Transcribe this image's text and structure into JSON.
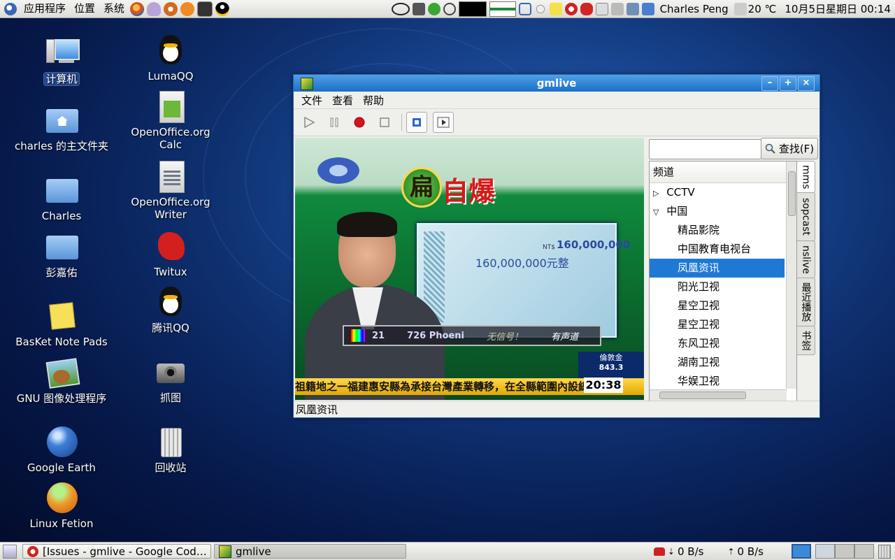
{
  "top_panel": {
    "menus": [
      "应用程序",
      "位置",
      "系统"
    ],
    "user": "Charles Peng",
    "temperature": "20 ℃",
    "clock": "10月5日星期日 00:14"
  },
  "desktop_icons": [
    {
      "label": "计算机",
      "icon": "computer-icon"
    },
    {
      "label": "charles 的主文件夹",
      "icon": "home-folder-icon"
    },
    {
      "label": "Charles",
      "icon": "folder-icon"
    },
    {
      "label": "彭嘉佑",
      "icon": "folder-icon"
    },
    {
      "label": "BasKet Note Pads",
      "icon": "basket-notes-icon"
    },
    {
      "label": "GNU 图像处理程序",
      "icon": "gimp-icon"
    },
    {
      "label": "Google Earth",
      "icon": "google-earth-icon"
    },
    {
      "label": "Linux Fetion",
      "icon": "fetion-icon"
    },
    {
      "label": "LumaQQ",
      "icon": "qq-penguin-icon"
    },
    {
      "label": "OpenOffice.org Calc",
      "icon": "calc-icon"
    },
    {
      "label": "OpenOffice.org Writer",
      "icon": "writer-icon"
    },
    {
      "label": "Twitux",
      "icon": "twitux-icon"
    },
    {
      "label": "腾讯QQ",
      "icon": "qq-penguin-icon"
    },
    {
      "label": "抓图",
      "icon": "camera-icon"
    },
    {
      "label": "回收站",
      "icon": "trash-icon"
    }
  ],
  "window": {
    "title": "gmlive",
    "menus": [
      "文件",
      "查看",
      "帮助"
    ],
    "search_button": "查找(F)",
    "search_value": "",
    "tree_header": "频道",
    "channels": [
      {
        "label": "CCTV",
        "level": 0,
        "expander": "▷"
      },
      {
        "label": "中国",
        "level": 0,
        "expander": "▽"
      },
      {
        "label": "精品影院",
        "level": 1
      },
      {
        "label": "中国教育电视台",
        "level": 1
      },
      {
        "label": "凤凰资讯",
        "level": 1,
        "selected": true
      },
      {
        "label": "阳光卫视",
        "level": 1
      },
      {
        "label": "星空卫视",
        "level": 1
      },
      {
        "label": "星空卫视",
        "level": 1
      },
      {
        "label": "东风卫视",
        "level": 1
      },
      {
        "label": "湖南卫视",
        "level": 1
      },
      {
        "label": "华娱卫视",
        "level": 1
      }
    ],
    "side_tabs": [
      "mms",
      "sopcast",
      "nslive",
      "最近播放",
      "书签"
    ],
    "status": "凤凰资讯",
    "video": {
      "headline_char1": "扁",
      "headline_rest": "自爆",
      "check_amount": "160,000,000",
      "check_amount_cn": "160,000,000元整",
      "check_currency": "NT$",
      "channel_num": "21",
      "channel_name": "726 Phoeni",
      "no_signal": "无信号！",
      "with_sound": "有声道",
      "ticker": "祖籍地之一福建惠安縣為承接台灣產業轉移，在全縣範圍內設總",
      "market_label": "倫敦金",
      "market_value": "843.3",
      "time": "20:38"
    }
  },
  "bottom_panel": {
    "tasks": [
      "[Issues - gmlive - Google Cod…",
      "gmlive"
    ],
    "download": "0 B/s",
    "upload": "0 B/s"
  }
}
